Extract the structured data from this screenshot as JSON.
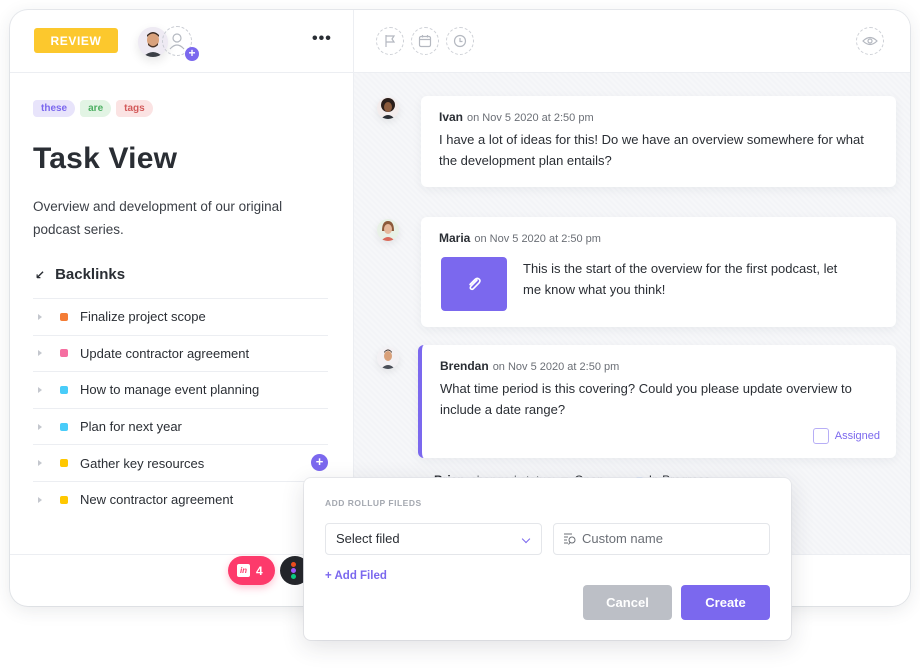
{
  "colors": {
    "accent": "#7b68ee",
    "review": "#fcc82d",
    "invision": "#fd3a6b"
  },
  "left": {
    "status_button": "REVIEW",
    "more_menu": "•••",
    "tags": [
      "these",
      "are",
      "tags"
    ],
    "title": "Task View",
    "description": "Overview and development of our original podcast series.",
    "backlinks_heading": "Backlinks",
    "backlinks_arrow": "↙",
    "backlinks": [
      {
        "label": "Finalize project scope",
        "color": "#f47c35"
      },
      {
        "label": "Update contractor agreement",
        "color": "#f56fa1"
      },
      {
        "label": "How to manage event planning",
        "color": "#49ccf9"
      },
      {
        "label": "Plan for next year",
        "color": "#49ccf9"
      },
      {
        "label": "Gather key resources",
        "color": "#ffc800"
      },
      {
        "label": "New contractor agreement",
        "color": "#ffc800"
      }
    ],
    "add_backlink": "+",
    "integrations": {
      "invision_count": "4",
      "invision_icon": "in"
    }
  },
  "right": {
    "header_icons": [
      "flag-icon",
      "calendar-icon",
      "clock-icon",
      "eye-icon"
    ],
    "comments": [
      {
        "author": "Ivan",
        "when": "on Nov 5 2020 at 2:50 pm",
        "text": "I have a lot of ideas for this! Do we have an overview somewhere for what the development plan entails?"
      },
      {
        "author": "Maria",
        "when": "on Nov 5 2020 at 2:50 pm",
        "text": "This is the start of the overview for the first podcast, let me know what you think!",
        "attachment": "paperclip-icon"
      },
      {
        "author": "Brendan",
        "when": "on Nov 5 2020 at 2:50 pm",
        "text": "What time period is this covering? Could you please update overview to include a date range?",
        "assigned_label": "Assigned"
      }
    ],
    "activity": {
      "actor": "Brian",
      "action": "changed status:",
      "from": "Open",
      "from_color": "#b9bcc3",
      "arrow": "→",
      "to": "In Progress",
      "to_color": "#3b82f6"
    }
  },
  "popup": {
    "title": "ADD ROLLUP FILEDS",
    "select_value": "Select filed",
    "custom_placeholder": "Custom name",
    "add_link": "+ Add Filed",
    "cancel": "Cancel",
    "create": "Create"
  }
}
